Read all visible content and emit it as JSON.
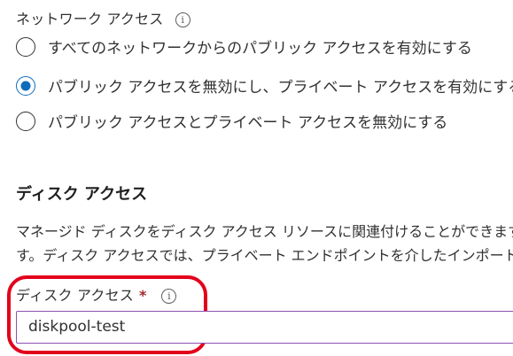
{
  "network_access": {
    "label": "ネットワーク アクセス",
    "info_icon": "info-icon",
    "options": [
      {
        "label": "すべてのネットワークからのパブリック アクセスを有効にする",
        "checked": false
      },
      {
        "label": "パブリック アクセスを無効にし、プライベート アクセスを有効にする",
        "checked": true
      },
      {
        "label": "パブリック アクセスとプライベート アクセスを無効にする",
        "checked": false
      }
    ]
  },
  "disk_access": {
    "heading": "ディスク アクセス",
    "description_line1": "マネージド ディスクをディスク アクセス リソースに関連付けることができます",
    "description_line2": "す。ディスク アクセスでは、プライベート エンドポイントを介したインポートお",
    "field_label": "ディスク アクセス",
    "required_mark": "*",
    "field_value": "diskpool-test"
  },
  "colors": {
    "accent": "#0f6cbd",
    "highlight": "#e3001b",
    "field_border": "#8a50b3",
    "required": "#a4262c"
  }
}
